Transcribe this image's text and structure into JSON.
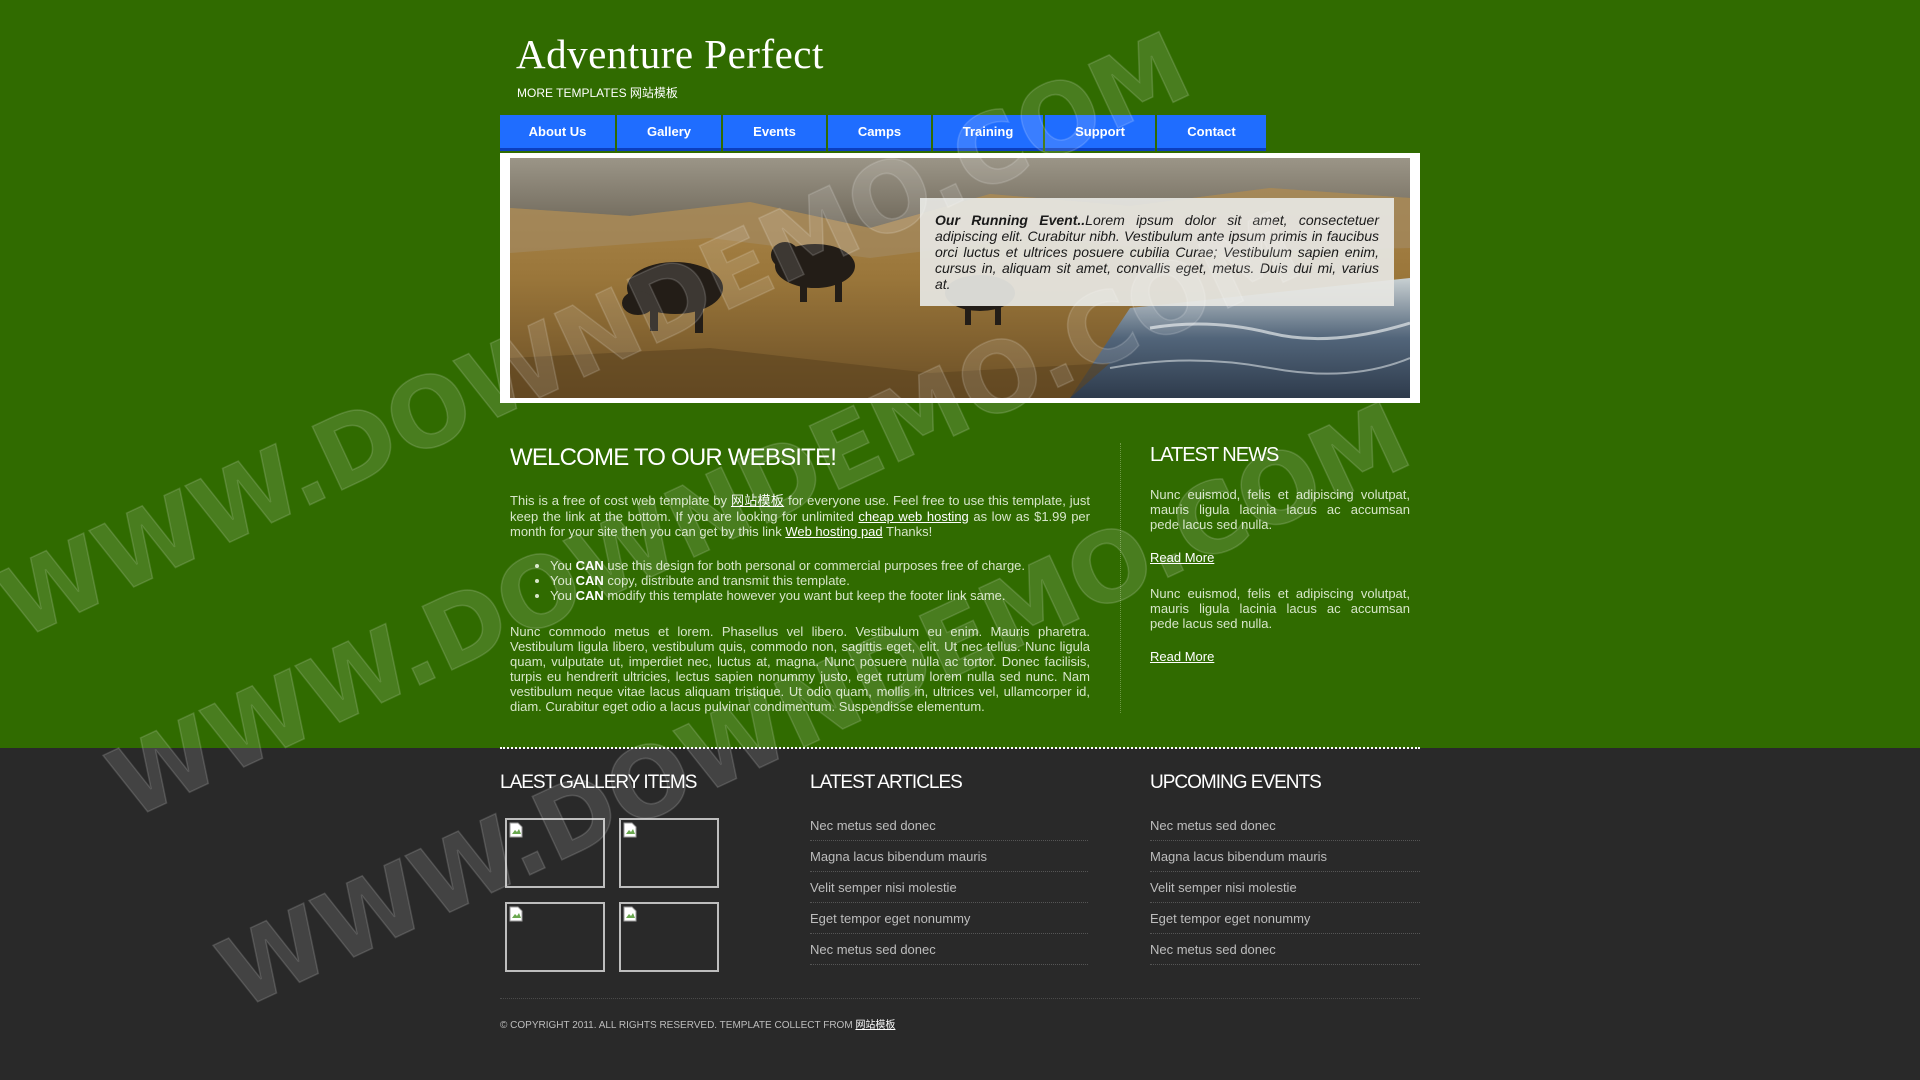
{
  "site": {
    "title": "Adventure Perfect",
    "subtitle": "MORE TEMPLATES 网站模板"
  },
  "nav": {
    "items": [
      {
        "label": "About Us"
      },
      {
        "label": "Gallery"
      },
      {
        "label": "Events"
      },
      {
        "label": "Camps"
      },
      {
        "label": "Training"
      },
      {
        "label": "Support"
      },
      {
        "label": "Contact"
      }
    ]
  },
  "banner": {
    "caption_title": "Our Running Event..",
    "caption_text": "Lorem ipsum dolor sit amet, consectetuer adipiscing elit. Curabitur nibh. Vestibulum ante ipsum primis in faucibus orci luctus et ultrices posuere cubilia Curae; Vestibulum sapien enim, cursus in, aliquam sit amet, convallis eget, metus. Duis dui mi, varius at."
  },
  "welcome": {
    "heading": "WELCOME TO OUR WEBSITE!",
    "intro_1": "This is a free of cost web template by ",
    "intro_link_1": "网站模板",
    "intro_2": " for everyone use. Feel free to use this template, just keep the link at the bottom. If you are looking for unlimited ",
    "intro_link_2": "cheap web hosting",
    "intro_3": " as low as $1.99 per month for your site then you can get by this link ",
    "intro_link_3": "Web hosting pad",
    "intro_4": " Thanks!",
    "bullets": [
      {
        "pre": "You ",
        "strong": "CAN",
        "post": " use this design for both personal or commercial purposes free of charge."
      },
      {
        "pre": "You ",
        "strong": "CAN",
        "post": " copy, distribute and transmit this template."
      },
      {
        "pre": "You ",
        "strong": "CAN",
        "post": " modify this template however you want but keep the footer link same."
      }
    ],
    "body": "Nunc commodo metus et lorem. Phasellus vel libero. Vestibulum eu enim. Mauris pharetra. Vestibulum ligula libero, vestibulum quis, commodo non, sagittis eget, elit. Ut nec tellus. Nunc ligula quam, vulputate ut, imperdiet nec, luctus at, magna. Nunc posuere nulla ac tortor. Donec facilisis, turpis eu hendrerit ultricies, lectus sapien nonummy justo, eget rutrum lorem nulla sed nunc. Nam vestibulum neque vitae lacus aliquam tristique. Ut odio quam, mollis in, ultrices vel, ullamcorper id, diam. Curabitur eget odio a lacus pulvinar condimentum. Suspendisse elementum."
  },
  "news": {
    "heading": "LATEST NEWS",
    "items": [
      {
        "text": "Nunc euismod, felis et adipiscing volutpat, mauris ligula lacinia lacus ac accumsan pede lacus sed nulla.",
        "link": "Read More"
      },
      {
        "text": "Nunc euismod, felis et adipiscing volutpat, mauris ligula lacinia lacus ac accumsan pede lacus sed nulla.",
        "link": "Read More"
      }
    ]
  },
  "footer": {
    "gallery_heading": "LAEST GALLERY ITEMS",
    "articles_heading": "LATEST ARTICLES",
    "articles": [
      "Nec metus sed donec",
      "Magna lacus bibendum mauris",
      "Velit semper nisi molestie",
      "Eget tempor eget nonummy",
      "Nec metus sed donec"
    ],
    "events_heading": "UPCOMING EVENTS",
    "events": [
      "Nec metus sed donec",
      "Magna lacus bibendum mauris",
      "Velit semper nisi molestie",
      "Eget tempor eget nonummy",
      "Nec metus sed donec"
    ],
    "copyright": "© COPYRIGHT 2011. ALL RIGHTS RESERVED. TEMPLATE COLLECT FROM ",
    "copyright_link": "网站模板"
  },
  "watermark": "WWW.DOWNDEMO.COM",
  "colors": {
    "page_green": "#306b00",
    "footer_dark": "#292929",
    "nav_blue": "#1f6dff"
  }
}
